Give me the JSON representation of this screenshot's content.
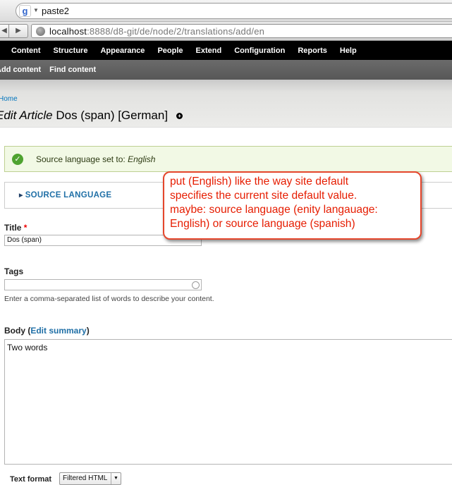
{
  "browser": {
    "search_text": "paste2",
    "google_logo": "g",
    "url_host": "localhost",
    "url_rest": ":8888/d8-git/de/node/2/translations/add/en",
    "back_glyph": "◀",
    "forward_glyph": "▶"
  },
  "toolbar": {
    "items": [
      "Content",
      "Structure",
      "Appearance",
      "People",
      "Extend",
      "Configuration",
      "Reports",
      "Help"
    ]
  },
  "shortcuts": {
    "items": [
      "Add content",
      "Find content"
    ]
  },
  "header": {
    "breadcrumb": "Home",
    "title_prefix": "Edit Article",
    "title_rest": " Dos (span) [German]"
  },
  "message": {
    "text": "Source language set to: ",
    "value": "English"
  },
  "fieldset": {
    "legend": "SOURCE LANGUAGE"
  },
  "form": {
    "title_label": "Title",
    "required_mark": "*",
    "title_value": "Dos (span)",
    "tags_label": "Tags",
    "tags_value": "",
    "tags_description": "Enter a comma-separated list of words to describe your content.",
    "body_label": "Body",
    "edit_summary": "Edit summary",
    "body_value": "Two words",
    "text_format_label": "Text format",
    "text_format_value": "Filtered HTML"
  },
  "annotation": {
    "lines": [
      "put (English) like the way site default",
      "specifies the current site default value.",
      "maybe: source language (enity langauage:",
      "English) or source language (spanish)"
    ]
  },
  "colors": {
    "annotation_border": "#e5462c",
    "annotation_text": "#e61c00",
    "link": "#1f6fa6",
    "toolbar": "#000000",
    "success": "#4fa330"
  },
  "icons": {
    "check": "check-icon",
    "add_shortcut": "plus-icon",
    "globe": "globe-icon",
    "autocomplete": "throbber-icon"
  }
}
